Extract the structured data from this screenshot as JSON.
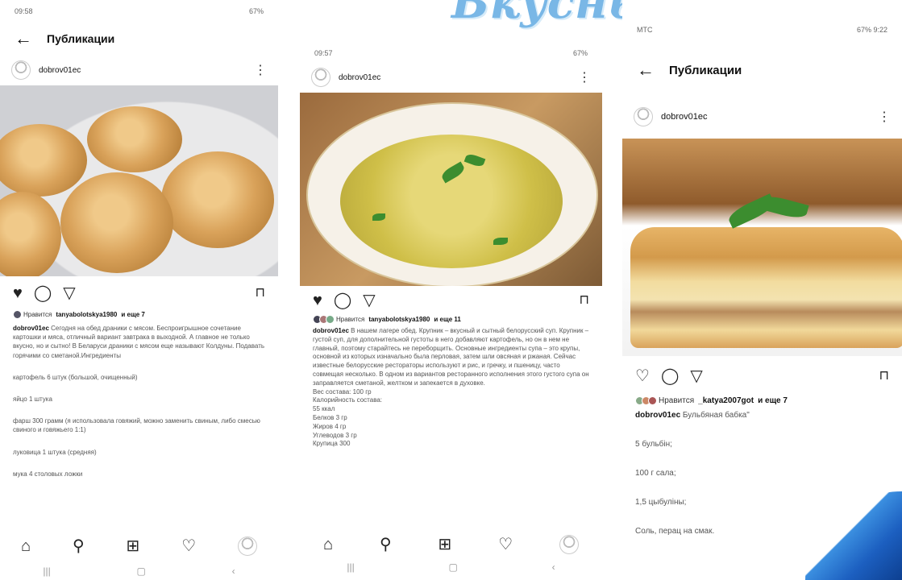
{
  "banner": {
    "text": "Вкусный обед"
  },
  "phone1": {
    "status_time": "09:58",
    "status_right": "67%",
    "header_title": "Публикации",
    "username": "dobrov01ec",
    "likes_prefix": "Нравится",
    "likes_user": "tanyabolotskya1980",
    "likes_suffix": "и еще 7",
    "caption_user": "dobrov01ec",
    "caption_text": "Сегодня на обед драники с мясом. Беспроигрышное сочетание картошки и мяса, отличный вариант завтрака в выходной. А главное не только вкусно, но и сытно! В Беларуси драники с мясом еще называют Колдуны. Подавать горячими со сметаной.Ингредиенты",
    "lines": [
      "картофель 6 штук (большой, очищенный)",
      "яйцо 1 штука",
      "фарш 300 грамм (я использовала говяжий, можно заменить свиным, либо смесью свиного и говяжьего 1:1)",
      "луковица 1 штука (средняя)",
      "мука 4 столовых ложки"
    ]
  },
  "phone2": {
    "status_time": "09:57",
    "status_right": "67%",
    "username": "dobrov01ec",
    "likes_prefix": "Нравится",
    "likes_user": "tanyabolotskya1980",
    "likes_suffix": "и еще 11",
    "caption_user": "dobrov01ec",
    "caption_text": "В нашем лагере обед. Крупник – вкусный и сытный белорусский суп. Крупник – густой суп, для дополнительной густоты в него добавляют картофель, но он в нем не главный, поэтому старайтесь не переборщить. Основные ингредиенты супа – это крупы, основной из которых изначально была перловая, затем шли овсяная и ржаная. Сейчас известные белорусские рестораторы используют и рис, и гречку, и пшеницу, часто совмещая несколько. В одном из вариантов ресторанного исполнения этого густого супа он заправляется сметаной, желтком и запекается в духовке.",
    "facts": [
      "Вес состава: 100 гр",
      "Калорийность состава:",
      "55 ккал",
      "Белков 3 гр",
      "Жиров 4 гр",
      "Углеводов 3 гр",
      "Крупица 300"
    ]
  },
  "phone3": {
    "status_left": "МТС",
    "status_right": "67% 9:22",
    "header_title": "Публикации",
    "username": "dobrov01ec",
    "likes_prefix": "Нравится",
    "likes_user": "_katya2007got",
    "likes_suffix": "и еще 7",
    "caption_user": "dobrov01ec",
    "caption_text": "Бульбяная бабка\"",
    "lines": [
      "5 бульбін;",
      "100 г сала;",
      "1,5 цыбуліны;",
      "Соль, перац на смак."
    ]
  },
  "colors": {
    "like": "#e0263b",
    "banner": "#79b7e6",
    "curl": "#1c5fc0"
  },
  "icons": [
    "heart-icon",
    "comment-icon",
    "share-icon",
    "bookmark-icon",
    "home-icon",
    "search-icon",
    "add-icon",
    "activity-icon",
    "profile-icon",
    "back-icon",
    "more-icon"
  ]
}
